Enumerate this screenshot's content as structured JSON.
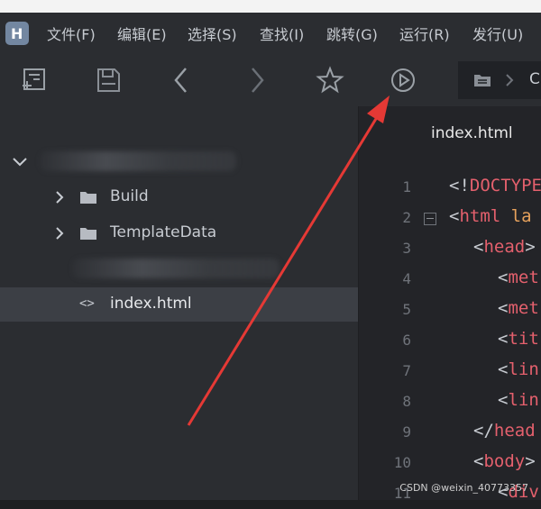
{
  "logo": {
    "letter": "H"
  },
  "menu": {
    "items": [
      "文件(F)",
      "编辑(E)",
      "选择(S)",
      "查找(I)",
      "跳转(G)",
      "运行(R)",
      "发行(U)"
    ]
  },
  "toolbar": {
    "buttons": [
      {
        "icon": "new-file-icon"
      },
      {
        "icon": "save-icon"
      },
      {
        "icon": "back-arrow-icon"
      },
      {
        "icon": "forward-arrow-icon"
      },
      {
        "icon": "star-icon"
      },
      {
        "icon": "run-icon"
      }
    ],
    "breadcrumb_partial": "C"
  },
  "sidebar": {
    "items": [
      {
        "label": "",
        "obscured": true
      },
      {
        "label": "Build",
        "type": "folder"
      },
      {
        "label": "TemplateData",
        "type": "folder"
      },
      {
        "label": "",
        "obscured": true
      },
      {
        "label": "index.html",
        "type": "html-file",
        "active": true
      }
    ]
  },
  "editor": {
    "tab": "index.html",
    "lines": [
      {
        "n": "1",
        "text": "<!DOCTYPE",
        "indent": 0
      },
      {
        "n": "2",
        "text": "<html la",
        "indent": 0,
        "fold": true
      },
      {
        "n": "3",
        "text": "<head>",
        "indent": 1
      },
      {
        "n": "4",
        "text": "<met",
        "indent": 2
      },
      {
        "n": "5",
        "text": "<met",
        "indent": 2
      },
      {
        "n": "6",
        "text": "<tit",
        "indent": 2
      },
      {
        "n": "7",
        "text": "<lin",
        "indent": 2
      },
      {
        "n": "8",
        "text": "<lin",
        "indent": 2
      },
      {
        "n": "9",
        "text": "</head",
        "indent": 1
      },
      {
        "n": "10",
        "text": "<body>",
        "indent": 1
      },
      {
        "n": "11",
        "text": "<div",
        "indent": 2
      }
    ]
  },
  "watermark": "CSDN @weixin_40773357",
  "colors": {
    "annotation_arrow": "#e53935",
    "tag": "#e4606d",
    "attr": "#e6a15c"
  }
}
